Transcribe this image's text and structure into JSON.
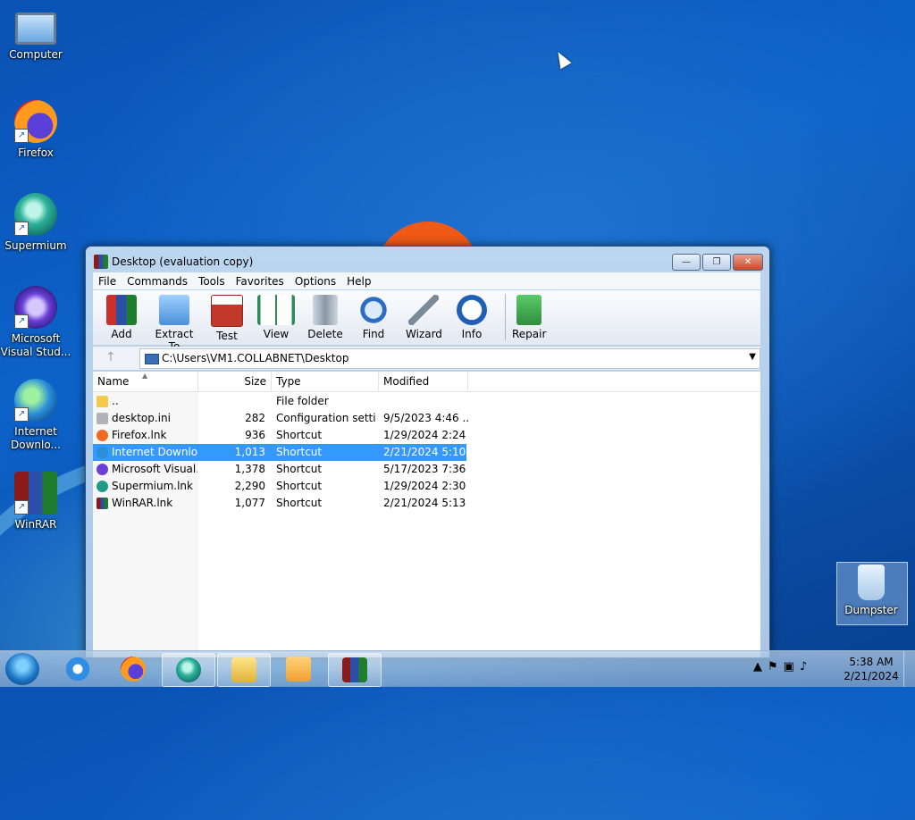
{
  "desktop": {
    "icons": [
      {
        "label": "Computer"
      },
      {
        "label": "Firefox"
      },
      {
        "label": "Supermium"
      },
      {
        "label": "Microsoft Visual Stud..."
      },
      {
        "label": "Internet Downlo..."
      },
      {
        "label": "WinRAR"
      },
      {
        "label": "Dumpster"
      }
    ]
  },
  "window": {
    "title": "Desktop (evaluation copy)",
    "buttons": {
      "minimize": "—",
      "maximize": "❐",
      "close": "✕"
    },
    "menu": [
      "File",
      "Commands",
      "Tools",
      "Favorites",
      "Options",
      "Help"
    ],
    "toolbar": [
      {
        "label": "Add",
        "icon": "add-archive-icon",
        "color": "#c9312a"
      },
      {
        "label": "Extract To",
        "icon": "extract-folder-icon",
        "color": "#4a90d9"
      },
      {
        "label": "Test",
        "icon": "test-clipboard-icon",
        "color": "#c0392b"
      },
      {
        "label": "View",
        "icon": "view-book-icon",
        "color": "#2e8b57"
      },
      {
        "label": "Delete",
        "icon": "trash-icon",
        "color": "#8a97a6"
      },
      {
        "label": "Find",
        "icon": "magnifier-icon",
        "color": "#2b6cc4"
      },
      {
        "label": "Wizard",
        "icon": "wand-icon",
        "color": "#7a8a99"
      },
      {
        "label": "Info",
        "icon": "info-icon",
        "color": "#1f5fb8"
      },
      {
        "label": "Repair",
        "icon": "repair-kit-icon",
        "color": "#3aa64a"
      }
    ],
    "address": "C:\\Users\\VM1.COLLABNET\\Desktop",
    "columns": {
      "name": "Name",
      "size": "Size",
      "type": "Type",
      "modified": "Modified"
    },
    "files": [
      {
        "name": "..",
        "size": "",
        "type": "File folder",
        "modified": "",
        "icon": "folder-icon",
        "color": "#f2c94c",
        "selected": false
      },
      {
        "name": "desktop.ini",
        "size": "282",
        "type": "Configuration setti...",
        "modified": "9/5/2023 4:46 ...",
        "icon": "config-file-icon",
        "color": "#b0b4ba",
        "selected": false
      },
      {
        "name": "Firefox.lnk",
        "size": "936",
        "type": "Shortcut",
        "modified": "1/29/2024 2:24 ...",
        "icon": "firefox-icon",
        "color": "#f26722",
        "selected": false
      },
      {
        "name": "Internet Downlo...",
        "size": "1,013",
        "type": "Shortcut",
        "modified": "2/21/2024 5:10 ...",
        "icon": "idm-icon",
        "color": "#2a8ed8",
        "selected": true
      },
      {
        "name": "Microsoft Visual...",
        "size": "1,378",
        "type": "Shortcut",
        "modified": "5/17/2023 7:36 ...",
        "icon": "visual-studio-icon",
        "color": "#6a3fd6",
        "selected": false
      },
      {
        "name": "Supermium.lnk",
        "size": "2,290",
        "type": "Shortcut",
        "modified": "1/29/2024 2:30 ...",
        "icon": "supermium-icon",
        "color": "#1f9c86",
        "selected": false
      },
      {
        "name": "WinRAR.lnk",
        "size": "1,077",
        "type": "Shortcut",
        "modified": "2/21/2024 5:13 ...",
        "icon": "winrar-icon",
        "color": "#8b1a1a",
        "selected": false
      }
    ]
  },
  "taskbar": {
    "items": [
      {
        "icon": "internet-explorer-icon",
        "color": "#2f8de4",
        "active": false
      },
      {
        "icon": "firefox-icon",
        "color": "#f26722",
        "active": false
      },
      {
        "icon": "supermium-icon",
        "color": "#1f9c86",
        "active": true
      },
      {
        "icon": "file-explorer-icon",
        "color": "#f2c94c",
        "active": true
      },
      {
        "icon": "media-player-icon",
        "color": "#f0a030",
        "active": false
      },
      {
        "icon": "winrar-icon",
        "color": "#8b1a1a",
        "active": true
      }
    ],
    "time": "5:38 AM",
    "date": "2/21/2024"
  }
}
